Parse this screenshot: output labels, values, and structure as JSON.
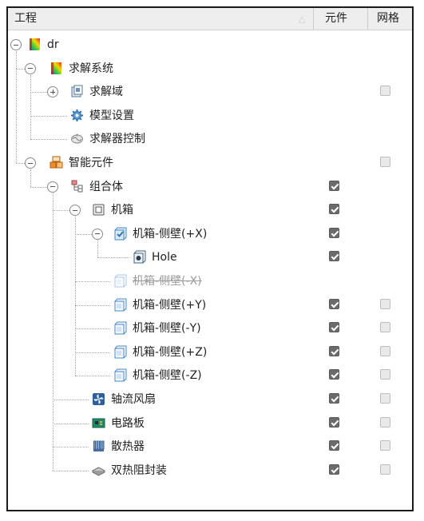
{
  "columns": {
    "name": "工程",
    "element": "元件",
    "mesh": "网格"
  },
  "tree": [
    {
      "label": "dr",
      "icon": "project-rainbow-icon",
      "expander": "minus"
    },
    {
      "label": "求解系统",
      "icon": "solve-system-icon",
      "expander": "minus"
    },
    {
      "label": "求解域",
      "icon": "domain-box-icon",
      "expander": "plus",
      "mesh_checked": false
    },
    {
      "label": "模型设置",
      "icon": "model-settings-gear-icon"
    },
    {
      "label": "求解器控制",
      "icon": "solver-control-icon"
    },
    {
      "label": "智能元件",
      "icon": "smart-components-icon",
      "expander": "minus",
      "mesh_checked": false
    },
    {
      "label": "组合体",
      "icon": "assembly-icon",
      "expander": "minus",
      "element_checked": true
    },
    {
      "label": "机箱",
      "icon": "chassis-icon",
      "expander": "minus",
      "element_checked": true
    },
    {
      "label": "机箱-侧壁(+X)",
      "icon": "wall-check-icon",
      "expander": "minus",
      "element_checked": true
    },
    {
      "label": "Hole",
      "icon": "hole-icon",
      "element_checked": true
    },
    {
      "label": "机箱-侧壁(-X)",
      "icon": "wall-icon",
      "disabled": true
    },
    {
      "label": "机箱-侧壁(+Y)",
      "icon": "wall-icon",
      "element_checked": true,
      "mesh_checked": false
    },
    {
      "label": "机箱-侧壁(-Y)",
      "icon": "wall-icon",
      "element_checked": true,
      "mesh_checked": false
    },
    {
      "label": "机箱-侧壁(+Z)",
      "icon": "wall-icon",
      "element_checked": true,
      "mesh_checked": false
    },
    {
      "label": "机箱-侧壁(-Z)",
      "icon": "wall-icon",
      "element_checked": true,
      "mesh_checked": false
    },
    {
      "label": "轴流风扇",
      "icon": "axial-fan-icon",
      "element_checked": true,
      "mesh_checked": false
    },
    {
      "label": "电路板",
      "icon": "circuit-board-icon",
      "element_checked": true,
      "mesh_checked": false
    },
    {
      "label": "散热器",
      "icon": "heatsink-icon",
      "element_checked": true,
      "mesh_checked": false
    },
    {
      "label": "双热阻封装",
      "icon": "two-resistor-package-icon",
      "element_checked": true,
      "mesh_checked": false
    }
  ]
}
